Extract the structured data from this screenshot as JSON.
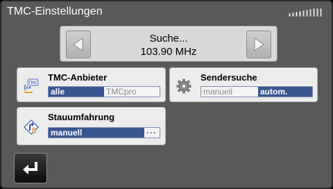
{
  "header": {
    "title": "TMC-Einstellungen",
    "signal_icon": "signal-strength-icon",
    "signal_level": 0.4
  },
  "frequency": {
    "status": "Suche...",
    "value": "103.90 MHz",
    "prev_icon": "arrow-left-icon",
    "next_icon": "arrow-right-icon"
  },
  "provider": {
    "label": "TMC-Anbieter",
    "icon": "tmc-broadcast-icon",
    "options": [
      "alle",
      "TMCpro"
    ],
    "selected": "alle"
  },
  "station_search": {
    "label": "Sendersuche",
    "icon": "gear-icon",
    "options": [
      "manuell",
      "autom."
    ],
    "selected": "autom."
  },
  "detour": {
    "label": "Stauumfahrung",
    "icon": "detour-sign-icon",
    "value": "manuell",
    "more_label": "···"
  },
  "footer": {
    "back_icon": "back-arrow-icon"
  },
  "colors": {
    "background": "#59595a",
    "selected": "#3a5691",
    "tile": "#ececec"
  }
}
